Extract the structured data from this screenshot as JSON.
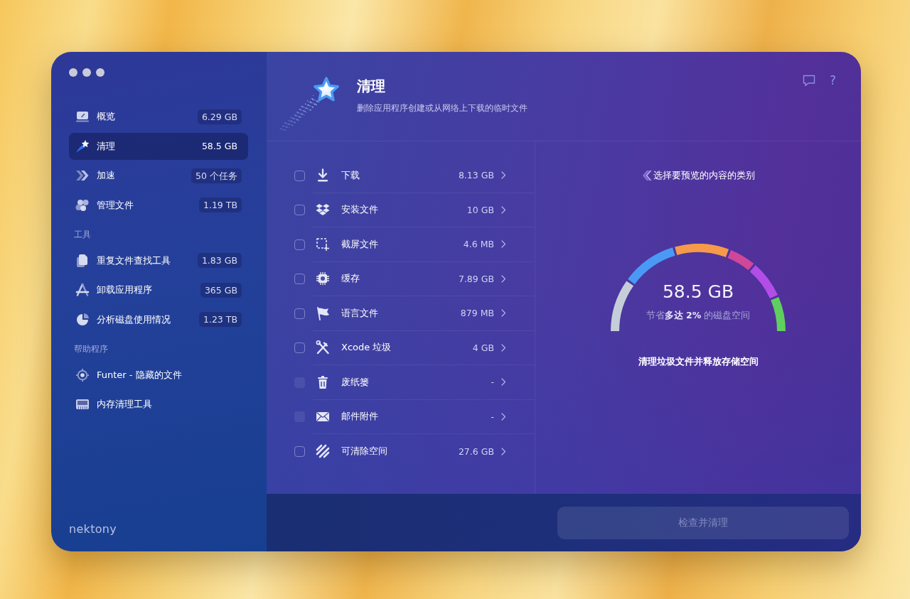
{
  "sidebar": {
    "items": [
      {
        "label": "概览",
        "badge": "6.29 GB",
        "selected": false
      },
      {
        "label": "清理",
        "badge": "58.5 GB",
        "selected": true
      },
      {
        "label": "加速",
        "badge": "50 个任务",
        "selected": false
      },
      {
        "label": "管理文件",
        "badge": "1.19 TB",
        "selected": false
      }
    ],
    "sections": [
      {
        "title": "工具",
        "items": [
          {
            "label": "重复文件查找工具",
            "badge": "1.83 GB",
            "selected": false
          },
          {
            "label": "卸载应用程序",
            "badge": "365 GB",
            "selected": false
          },
          {
            "label": "分析磁盘使用情况",
            "badge": "1.23 TB",
            "selected": false
          }
        ]
      },
      {
        "title": "帮助程序",
        "items": [
          {
            "label": "Funter - 隐藏的文件",
            "selected": false
          },
          {
            "label": "内存清理工具",
            "selected": false
          }
        ]
      }
    ],
    "logo": "nektony"
  },
  "header": {
    "title": "清理",
    "subtitle": "删除应用程序创建或从网络上下载的临时文件",
    "help": "?"
  },
  "categories": [
    {
      "label": "下载",
      "size": "8.13 GB",
      "checked": false,
      "disabled": false
    },
    {
      "label": "安装文件",
      "size": "10 GB",
      "checked": false,
      "disabled": false
    },
    {
      "label": "截屏文件",
      "size": "4.6 MB",
      "checked": false,
      "disabled": false
    },
    {
      "label": "缓存",
      "size": "7.89 GB",
      "checked": false,
      "disabled": false
    },
    {
      "label": "语言文件",
      "size": "879 MB",
      "checked": false,
      "disabled": false
    },
    {
      "label": "Xcode 垃圾",
      "size": "4 GB",
      "checked": false,
      "disabled": false
    },
    {
      "label": "废纸篓",
      "size": "-",
      "checked": false,
      "disabled": true
    },
    {
      "label": "邮件附件",
      "size": "-",
      "checked": false,
      "disabled": true
    },
    {
      "label": "可清除空间",
      "size": "27.6 GB",
      "checked": false,
      "disabled": false
    }
  ],
  "preview": {
    "hint": "选择要预览的内容的类别",
    "total": "58.5 GB",
    "savings": "节省**多达 2%** 的磁盘空间",
    "caption": "清理垃圾文件并释放存储空间"
  },
  "action_button": {
    "label": "检查并清理",
    "disabled": true
  }
}
